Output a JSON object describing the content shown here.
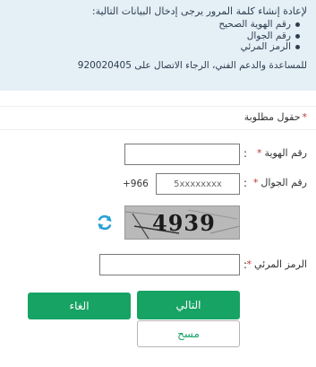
{
  "info": {
    "intro": "لإعادة إنشاء كلمة المرور يرجى إدخال البيانات التالية:",
    "items": [
      "رقم الهوية الصحيح",
      "رقم الجوال",
      "الرمز المرئي"
    ],
    "support": "للمساعدة والدعم الفني، الرجاء الاتصال على 920020405"
  },
  "form": {
    "required_note": "حقول مطلوبة",
    "id_label": "رقم الهوية",
    "mobile_label": "رقم الجوال",
    "mobile_prefix": "+966",
    "mobile_placeholder": "5xxxxxxxx",
    "captcha_label": "الرمز المرئي",
    "captcha_text": "4939",
    "colon": ":"
  },
  "buttons": {
    "next": "التالي",
    "cancel": "الغاء",
    "clear": "مسح"
  },
  "colors": {
    "primary": "#17a364",
    "info_bg": "#e5eff6",
    "required": "#c0392b",
    "refresh_icon": "#2a9fd6"
  },
  "icons": {
    "refresh": "refresh-icon"
  }
}
